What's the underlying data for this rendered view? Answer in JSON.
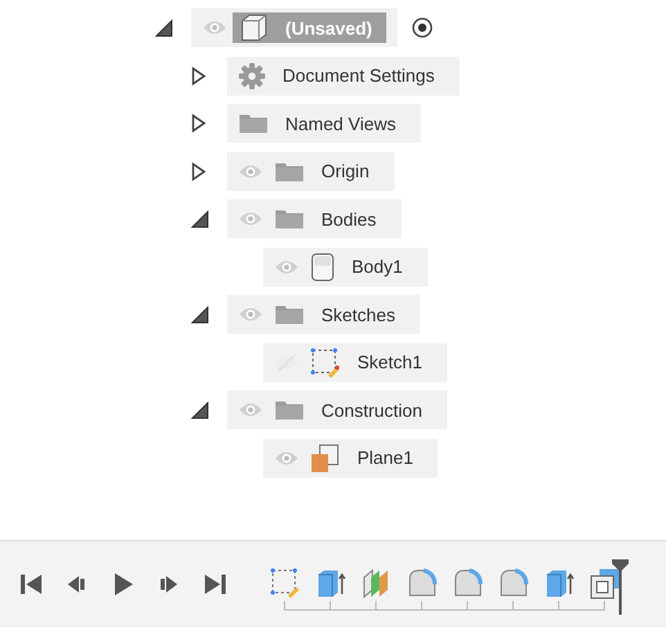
{
  "browser": {
    "root": {
      "label": "(Unsaved)",
      "kind": "component",
      "expanded": true,
      "visible": true,
      "selected": true,
      "active": true,
      "children": [
        {
          "label": "Document Settings",
          "kind": "gear",
          "expanded": false,
          "selected": false
        },
        {
          "label": "Named Views",
          "kind": "folder",
          "expanded": false,
          "selected": false
        },
        {
          "label": "Origin",
          "kind": "folder",
          "expanded": false,
          "visible": true,
          "selected": false
        },
        {
          "label": "Bodies",
          "kind": "folder",
          "expanded": true,
          "visible": true,
          "selected": false,
          "children": [
            {
              "label": "Body1",
              "kind": "body",
              "visible": true,
              "selected": false
            }
          ]
        },
        {
          "label": "Sketches",
          "kind": "folder",
          "expanded": true,
          "visible": true,
          "selected": false,
          "children": [
            {
              "label": "Sketch1",
              "kind": "sketch",
              "visible": false,
              "selected": false
            }
          ]
        },
        {
          "label": "Construction",
          "kind": "folder",
          "expanded": true,
          "visible": true,
          "selected": false,
          "children": [
            {
              "label": "Plane1",
              "kind": "plane",
              "visible": true,
              "selected": false
            }
          ]
        }
      ]
    }
  },
  "timeline": {
    "controls": [
      {
        "kind": "first"
      },
      {
        "kind": "previous"
      },
      {
        "kind": "play"
      },
      {
        "kind": "next"
      },
      {
        "kind": "last"
      }
    ],
    "features": [
      {
        "kind": "sketch"
      },
      {
        "kind": "extrude"
      },
      {
        "kind": "split"
      },
      {
        "kind": "fillet"
      },
      {
        "kind": "fillet"
      },
      {
        "kind": "fillet"
      },
      {
        "kind": "extrude"
      },
      {
        "kind": "shell"
      }
    ]
  }
}
